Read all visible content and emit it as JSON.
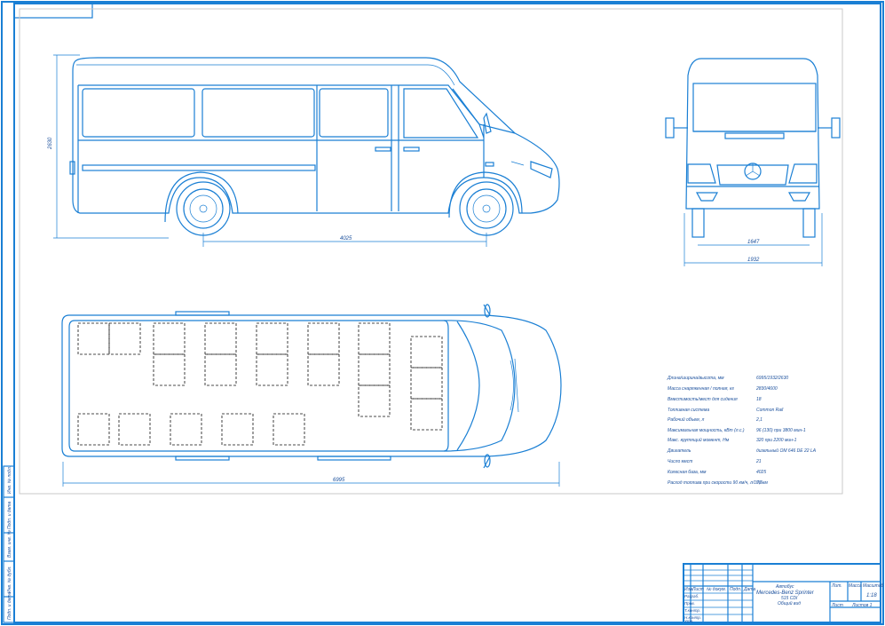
{
  "dimensions": {
    "side_height": "2630",
    "wheelbase": "4025",
    "front_track": "1647",
    "front_width": "1932",
    "overall_length": "6995"
  },
  "specs": [
    {
      "label": "Длина/ширина/высота, мм",
      "value": "6995/1932/2630"
    },
    {
      "label": "Масса снаряженная / полная, кг",
      "value": "2830/4600"
    },
    {
      "label": "Вместимость/мест для сидения",
      "value": "18"
    },
    {
      "label": "Топливная система",
      "value": "Common Rail"
    },
    {
      "label": "Рабочий объем, л",
      "value": "2,1"
    },
    {
      "label": "Максимальная мощность, кВт (л.с.)",
      "value": "96 (130) при 3800 мин-1"
    },
    {
      "label": "Макс. крутящий момент, Нм",
      "value": "320 при 2200 мин-1"
    },
    {
      "label": "Двигатель",
      "value": "дизельный OM 646 DE 22 LA"
    },
    {
      "label": "Число мест",
      "value": "21"
    },
    {
      "label": "Колесная база, мм",
      "value": "4025"
    },
    {
      "label": "Расход топлива при скорости 90 км/ч, л/100 км",
      "value": "7,6"
    }
  ],
  "title_block": {
    "doc_type": "Автобус",
    "name_line1": "Mercedes-Benz Sprinter",
    "name_line2": "515 CDI",
    "name_line3": "Общий вид",
    "header_cells": [
      "Изм.",
      "Лист",
      "№ докум.",
      "Подп.",
      "Дата"
    ],
    "row_labels": [
      "Разраб.",
      "Пров.",
      "Т.контр.",
      "Н.контр.",
      "Утв."
    ],
    "cols_right": [
      "Лит.",
      "Масса",
      "Масштаб"
    ],
    "scale": "1:18",
    "sheet_label": "Лист",
    "sheets_label": "Листов 1"
  },
  "left_strip": [
    "Инв. № подл.",
    "Подп. и дата",
    "Взам. инв. №",
    "Инв. № дубл.",
    "Подп. и дата"
  ]
}
